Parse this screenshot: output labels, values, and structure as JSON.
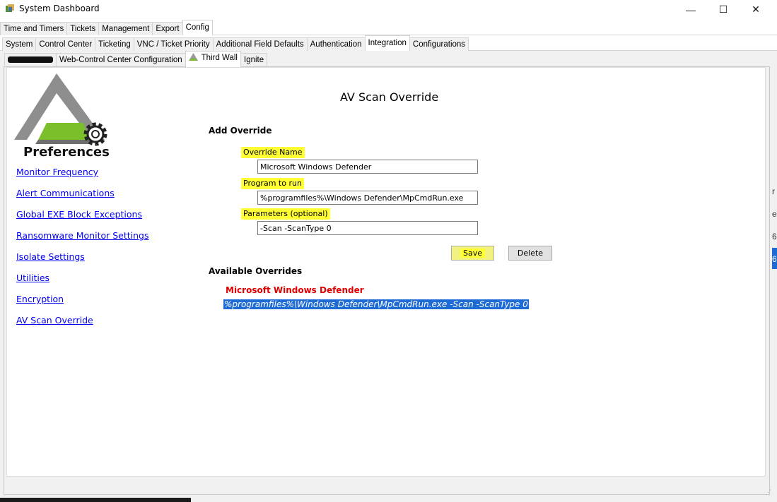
{
  "window": {
    "title": "System Dashboard",
    "minimize_glyph": "—",
    "maximize_glyph": "☐",
    "close_glyph": "✕"
  },
  "tabs_row1": [
    "Time and Timers",
    "Tickets",
    "Management",
    "Export",
    "Config"
  ],
  "tabs_row2": [
    "System",
    "Control Center",
    "Ticketing",
    "VNC / Ticket Priority",
    "Additional Field Defaults",
    "Authentication",
    "Integration",
    "Configurations"
  ],
  "tabs_row3": [
    "Web-Control Center Configuration",
    "Third Wall",
    "Ignite"
  ],
  "logo": {
    "text": "Preferences"
  },
  "sidebar": {
    "links": [
      "Monitor Frequency",
      "Alert Communications",
      "Global EXE Block Exceptions",
      "Ransomware Monitor Settings",
      "Isolate Settings",
      "Utilities",
      "Encryption",
      "AV Scan Override"
    ]
  },
  "main": {
    "title": "AV Scan Override",
    "add_override_heading": "Add Override",
    "override_name_label": "Override Name",
    "override_name_value": "Microsoft Windows Defender",
    "program_label": "Program to run",
    "program_value": "%programfiles%\\Windows Defender\\MpCmdRun.exe",
    "parameters_label": "Parameters (optional)",
    "parameters_value": "-Scan -ScanType 0",
    "save_label": "Save",
    "delete_label": "Delete",
    "available_heading": "Available Overrides",
    "override_item_name": "Microsoft Windows Defender",
    "override_item_command": "%programfiles%\\Windows Defender\\MpCmdRun.exe -Scan -ScanType 0"
  },
  "right_fragments": [
    "r",
    "e",
    "6",
    "6"
  ],
  "colors": {
    "highlight": "#ffff33",
    "link": "#0000ee",
    "override_name": "#e00000",
    "selection": "#1e6bd6"
  }
}
